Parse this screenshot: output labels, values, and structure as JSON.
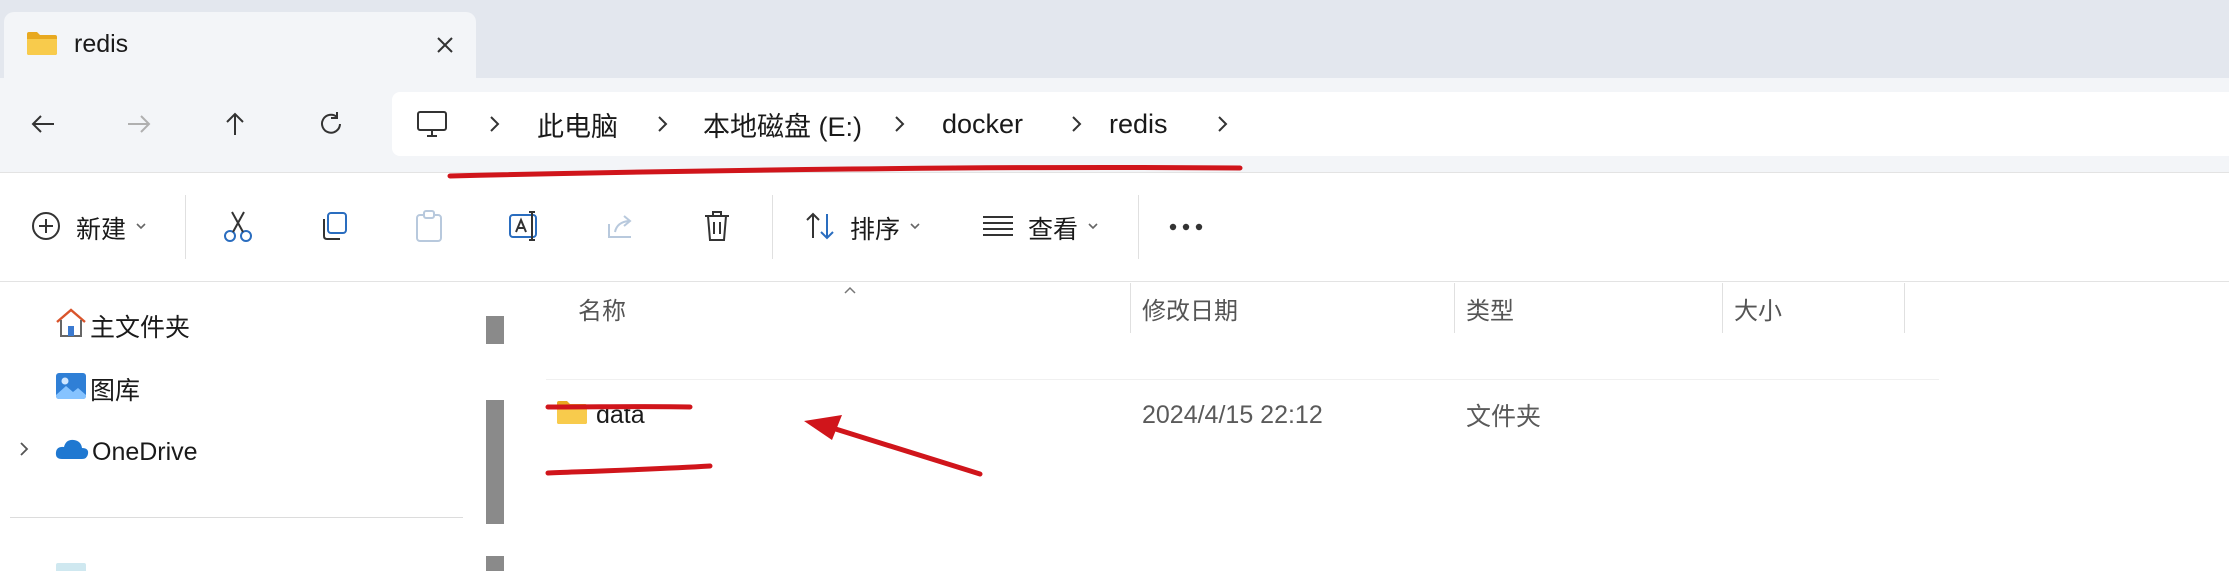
{
  "tab": {
    "title": "redis",
    "icon": "folder-icon",
    "close_icon": "close-icon"
  },
  "nav": {
    "back_icon": "back-arrow-icon",
    "forward_icon": "forward-arrow-icon",
    "up_icon": "up-arrow-icon",
    "refresh_icon": "refresh-icon"
  },
  "address": {
    "root_icon": "monitor-icon",
    "crumbs": [
      "此电脑",
      "本地磁盘 (E:)",
      "docker",
      "redis"
    ]
  },
  "toolbar": {
    "new_label": "新建",
    "sort_label": "排序",
    "view_label": "查看",
    "icons": [
      "plus-circle-icon",
      "cut-icon",
      "copy-icon",
      "paste-icon",
      "rename-icon",
      "share-icon",
      "delete-icon",
      "sort-icon",
      "view-icon",
      "more-icon"
    ]
  },
  "sidebar": {
    "items": [
      {
        "label": "主文件夹",
        "icon": "home-icon"
      },
      {
        "label": "图库",
        "icon": "gallery-icon"
      },
      {
        "label": "OneDrive",
        "icon": "cloud-icon"
      }
    ]
  },
  "columns": [
    "名称",
    "修改日期",
    "类型",
    "大小"
  ],
  "files": [
    {
      "name": "data",
      "modified": "2024/4/15 22:12",
      "type": "文件夹",
      "size": ""
    }
  ],
  "colors": {
    "annotation": "#d0151b",
    "folder": "#f6c343",
    "accent": "#0067c0"
  }
}
